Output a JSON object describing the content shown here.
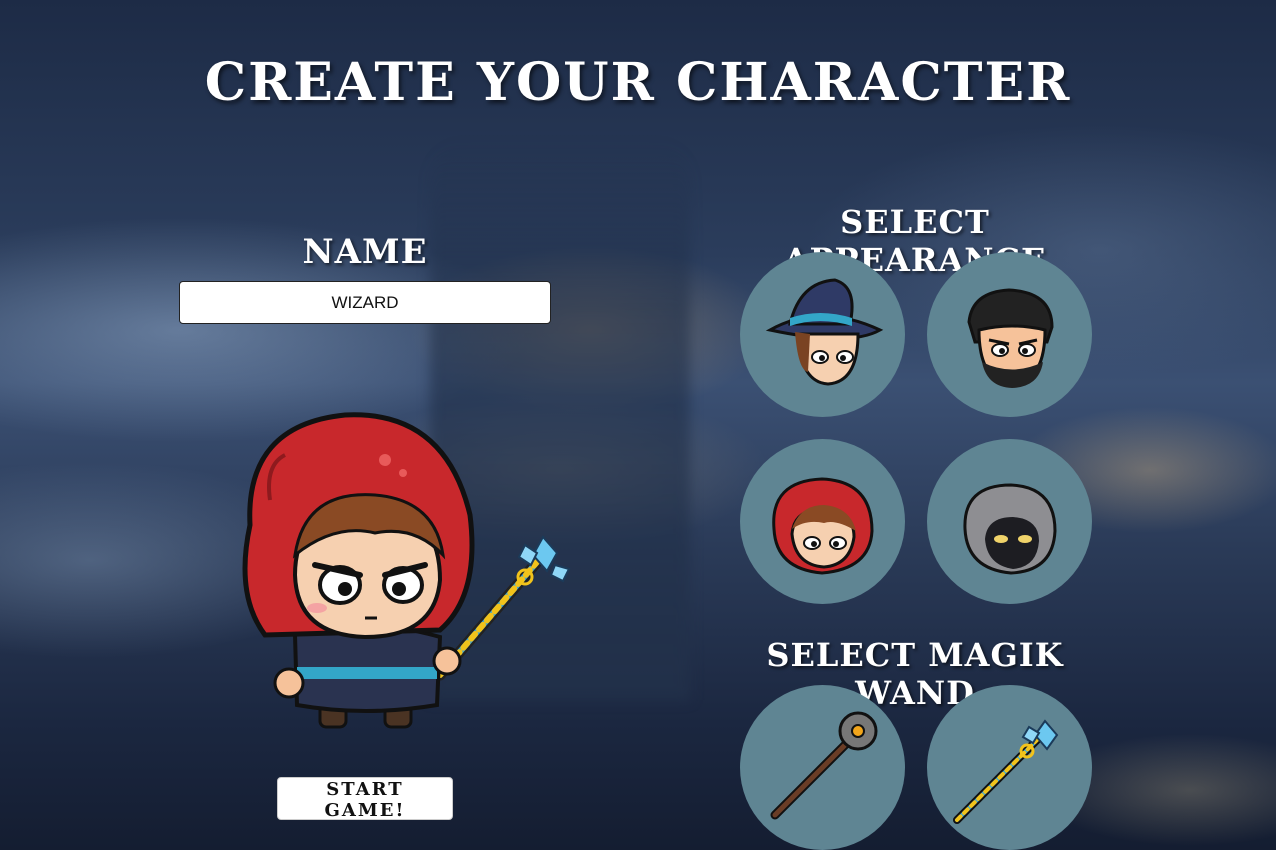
{
  "title": "CREATE YOUR CHARACTER",
  "name_section": {
    "label": "NAME",
    "input_value": "WIZARD"
  },
  "appearance_section": {
    "label": "SELECT APPEARANCE",
    "options": [
      "wizard-hat-head",
      "bearded-rogue-head",
      "red-hood-head",
      "grey-hood-head"
    ]
  },
  "wand_section": {
    "label": "SELECT MAGIK WAND",
    "options": [
      "dark-orb-staff",
      "crystal-wand"
    ]
  },
  "start_button": "START GAME!",
  "colors": {
    "option_circle": "#5f8593",
    "hood_red": "#c8282c",
    "title_text": "#ffffff"
  }
}
